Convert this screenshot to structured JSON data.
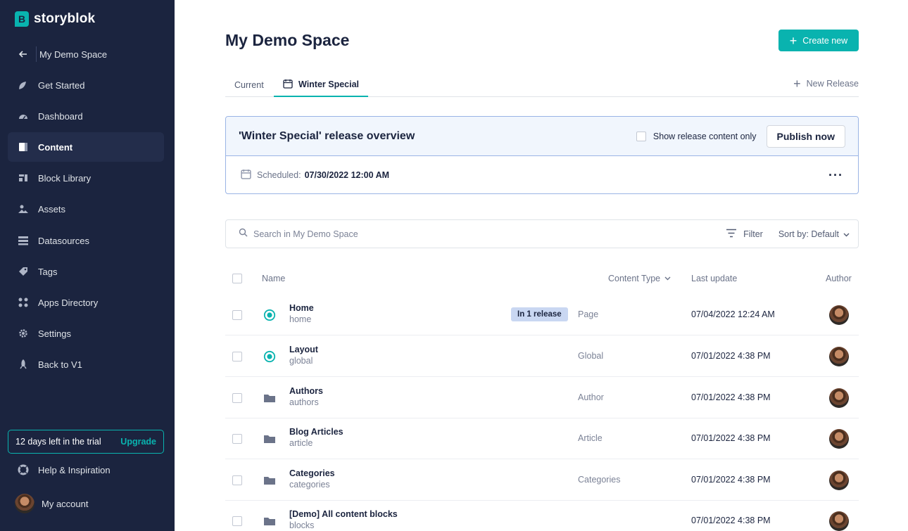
{
  "app": {
    "name": "storyblok"
  },
  "sidebar": {
    "back_label": "My Demo Space",
    "items": [
      {
        "label": "Get Started",
        "icon": "sprout-icon"
      },
      {
        "label": "Dashboard",
        "icon": "gauge-icon"
      },
      {
        "label": "Content",
        "icon": "content-icon"
      },
      {
        "label": "Block Library",
        "icon": "blocks-icon"
      },
      {
        "label": "Assets",
        "icon": "assets-icon"
      },
      {
        "label": "Datasources",
        "icon": "datasource-icon"
      },
      {
        "label": "Tags",
        "icon": "tag-icon"
      },
      {
        "label": "Apps Directory",
        "icon": "apps-icon"
      },
      {
        "label": "Settings",
        "icon": "gear-icon"
      },
      {
        "label": "Back to V1",
        "icon": "rocket-icon"
      }
    ],
    "active_item": "Content",
    "trial_text": "12 days left in the trial",
    "upgrade_label": "Upgrade",
    "help_label": "Help & Inspiration",
    "account_label": "My account"
  },
  "header": {
    "title": "My Demo Space",
    "create_label": "Create new"
  },
  "tabs": {
    "current": "Current",
    "winter": "Winter Special",
    "new_release": "New Release"
  },
  "release": {
    "title": "'Winter Special' release overview",
    "show_only_label": "Show release content only",
    "publish_label": "Publish now",
    "scheduled_label": "Scheduled:",
    "scheduled_value": "07/30/2022 12:00 AM"
  },
  "search": {
    "placeholder": "Search in My Demo Space",
    "filter_label": "Filter",
    "sort_label": "Sort by: Default"
  },
  "table": {
    "columns": {
      "name": "Name",
      "content_type": "Content Type",
      "last_update": "Last update",
      "author": "Author"
    },
    "rows": [
      {
        "title": "Home",
        "slug": "home",
        "type": "Page",
        "updated": "07/04/2022 12:24 AM",
        "icon": "story-icon",
        "badge": "In 1 release"
      },
      {
        "title": "Layout",
        "slug": "global",
        "type": "Global",
        "updated": "07/01/2022 4:38 PM",
        "icon": "story-icon"
      },
      {
        "title": "Authors",
        "slug": "authors",
        "type": "Author",
        "updated": "07/01/2022 4:38 PM",
        "icon": "folder-icon"
      },
      {
        "title": "Blog Articles",
        "slug": "article",
        "type": "Article",
        "updated": "07/01/2022 4:38 PM",
        "icon": "folder-icon"
      },
      {
        "title": "Categories",
        "slug": "categories",
        "type": "Categories",
        "updated": "07/01/2022 4:38 PM",
        "icon": "folder-icon"
      },
      {
        "title": "[Demo] All content blocks",
        "slug": "blocks",
        "type": "",
        "updated": "07/01/2022 4:38 PM",
        "icon": "folder-icon"
      }
    ]
  },
  "colors": {
    "sidebar": "#1b243f",
    "accent": "#09b3af",
    "badge": "#c9d7f2"
  }
}
